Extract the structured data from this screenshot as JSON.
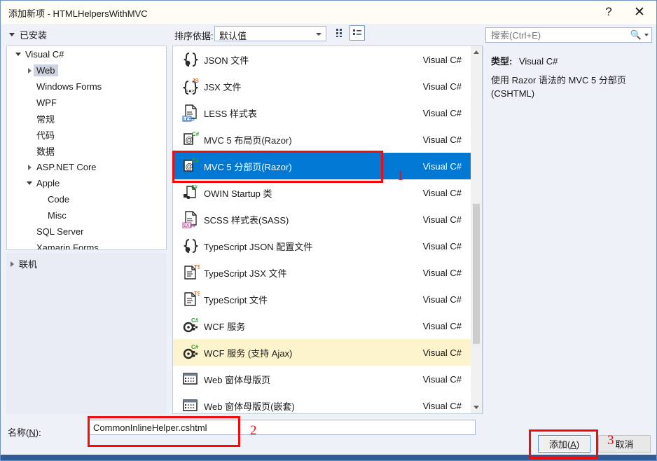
{
  "window": {
    "title": "添加新项 - HTMLHelpersWithMVC",
    "help_icon": "question-mark-icon",
    "close_icon": "close-icon"
  },
  "toolbar": {
    "installed_label": "已安装",
    "sortby_label": "排序依据:",
    "sort_value": "默认值",
    "grid_view_icon": "grid-view-icon",
    "list_view_icon": "list-view-icon"
  },
  "sidebar": {
    "items": [
      {
        "label": "Visual C#",
        "indent": 0,
        "twisty": "down",
        "selected": false
      },
      {
        "label": "Web",
        "indent": 1,
        "twisty": "right",
        "selected": true
      },
      {
        "label": "Windows Forms",
        "indent": 1,
        "twisty": "none",
        "selected": false
      },
      {
        "label": "WPF",
        "indent": 1,
        "twisty": "none",
        "selected": false
      },
      {
        "label": "常规",
        "indent": 1,
        "twisty": "none",
        "selected": false
      },
      {
        "label": "代码",
        "indent": 1,
        "twisty": "none",
        "selected": false
      },
      {
        "label": "数据",
        "indent": 1,
        "twisty": "none",
        "selected": false
      },
      {
        "label": "ASP.NET Core",
        "indent": 1,
        "twisty": "right",
        "selected": false
      },
      {
        "label": "Apple",
        "indent": 1,
        "twisty": "down",
        "selected": false
      },
      {
        "label": "Code",
        "indent": 2,
        "twisty": "none",
        "selected": false
      },
      {
        "label": "Misc",
        "indent": 2,
        "twisty": "none",
        "selected": false
      },
      {
        "label": "SQL Server",
        "indent": 1,
        "twisty": "none",
        "selected": false
      },
      {
        "label": "Xamarin.Forms",
        "indent": 1,
        "twisty": "none",
        "selected": false
      }
    ],
    "online_label": "联机"
  },
  "list": {
    "rows": [
      {
        "label": "JSON 文件",
        "lang": "Visual C#",
        "icon": "json-file-icon",
        "state": "normal"
      },
      {
        "label": "JSX 文件",
        "lang": "Visual C#",
        "icon": "jsx-file-icon",
        "state": "normal"
      },
      {
        "label": "LESS 样式表",
        "lang": "Visual C#",
        "icon": "less-stylesheet-icon",
        "state": "normal"
      },
      {
        "label": "MVC 5 布局页(Razor)",
        "lang": "Visual C#",
        "icon": "razor-layout-icon",
        "state": "normal"
      },
      {
        "label": "MVC 5 分部页(Razor)",
        "lang": "Visual C#",
        "icon": "razor-partial-icon",
        "state": "selected"
      },
      {
        "label": "OWIN Startup 类",
        "lang": "Visual C#",
        "icon": "owin-startup-icon",
        "state": "normal"
      },
      {
        "label": "SCSS 样式表(SASS)",
        "lang": "Visual C#",
        "icon": "scss-stylesheet-icon",
        "state": "normal"
      },
      {
        "label": "TypeScript JSON 配置文件",
        "lang": "Visual C#",
        "icon": "typescript-json-config-icon",
        "state": "normal"
      },
      {
        "label": "TypeScript JSX 文件",
        "lang": "Visual C#",
        "icon": "typescript-jsx-icon",
        "state": "normal"
      },
      {
        "label": "TypeScript 文件",
        "lang": "Visual C#",
        "icon": "typescript-file-icon",
        "state": "normal"
      },
      {
        "label": "WCF 服务",
        "lang": "Visual C#",
        "icon": "wcf-service-icon",
        "state": "normal"
      },
      {
        "label": "WCF 服务 (支持 Ajax)",
        "lang": "Visual C#",
        "icon": "wcf-service-ajax-icon",
        "state": "hover"
      },
      {
        "label": "Web 窗体母版页",
        "lang": "Visual C#",
        "icon": "web-master-page-icon",
        "state": "normal"
      },
      {
        "label": "Web 窗体母版页(嵌套)",
        "lang": "Visual C#",
        "icon": "web-master-page-nested-icon",
        "state": "normal"
      }
    ]
  },
  "search": {
    "placeholder": "搜索(Ctrl+E)",
    "value": "",
    "icon": "search-icon"
  },
  "details": {
    "type_label": "类型:",
    "type_value": "Visual C#",
    "description": "使用 Razor 语法的 MVC 5 分部页 (CSHTML)"
  },
  "bottom": {
    "name_label": "名称(N):",
    "name_value": "CommonInlineHelper.cshtml",
    "add_label": "添加(A)",
    "cancel_label": "取消"
  },
  "annotations": {
    "one": "1",
    "two": "2",
    "three": "3",
    "color": "#f40b0b"
  }
}
